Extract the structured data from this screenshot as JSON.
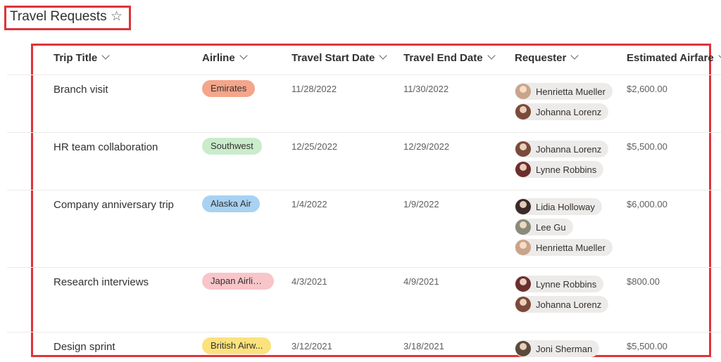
{
  "page": {
    "title": "Travel Requests",
    "favorite_icon": "star-outline-icon"
  },
  "columns": [
    {
      "label": "Trip Title"
    },
    {
      "label": "Airline"
    },
    {
      "label": "Travel Start Date"
    },
    {
      "label": "Travel End Date"
    },
    {
      "label": "Requester"
    },
    {
      "label": "Estimated Airfare"
    }
  ],
  "rows": [
    {
      "title": "Branch visit",
      "airline": {
        "label": "Emirates",
        "color": "#f4a58a"
      },
      "start": "11/28/2022",
      "end": "11/30/2022",
      "requesters": [
        {
          "name": "Henrietta Mueller",
          "avatar_color": "#c9a48a"
        },
        {
          "name": "Johanna Lorenz",
          "avatar_color": "#7a4a3a"
        }
      ],
      "airfare": "$2,600.00"
    },
    {
      "title": "HR team collaboration",
      "airline": {
        "label": "Southwest",
        "color": "#caeccb"
      },
      "start": "12/25/2022",
      "end": "12/29/2022",
      "requesters": [
        {
          "name": "Johanna Lorenz",
          "avatar_color": "#7a4a3a"
        },
        {
          "name": "Lynne Robbins",
          "avatar_color": "#6b2e2e"
        }
      ],
      "airfare": "$5,500.00"
    },
    {
      "title": "Company anniversary trip",
      "airline": {
        "label": "Alaska Air",
        "color": "#a8d2f3"
      },
      "start": "1/4/2022",
      "end": "1/9/2022",
      "requesters": [
        {
          "name": "Lidia Holloway",
          "avatar_color": "#3a2a2a"
        },
        {
          "name": "Lee Gu",
          "avatar_color": "#8a8a7a"
        },
        {
          "name": "Henrietta Mueller",
          "avatar_color": "#c9a48a"
        }
      ],
      "airfare": "$6,000.00"
    },
    {
      "title": "Research interviews",
      "airline": {
        "label": "Japan Airlines",
        "color": "#f8c5c9"
      },
      "start": "4/3/2021",
      "end": "4/9/2021",
      "requesters": [
        {
          "name": "Lynne Robbins",
          "avatar_color": "#6b2e2e"
        },
        {
          "name": "Johanna Lorenz",
          "avatar_color": "#7a4a3a"
        }
      ],
      "airfare": "$800.00"
    },
    {
      "title": "Design sprint",
      "airline": {
        "label": "British Airw...",
        "color": "#fbe27c"
      },
      "start": "3/12/2021",
      "end": "3/18/2021",
      "requesters": [
        {
          "name": "Joni Sherman",
          "avatar_color": "#5a4a3a"
        }
      ],
      "airfare": "$5,500.00"
    }
  ]
}
